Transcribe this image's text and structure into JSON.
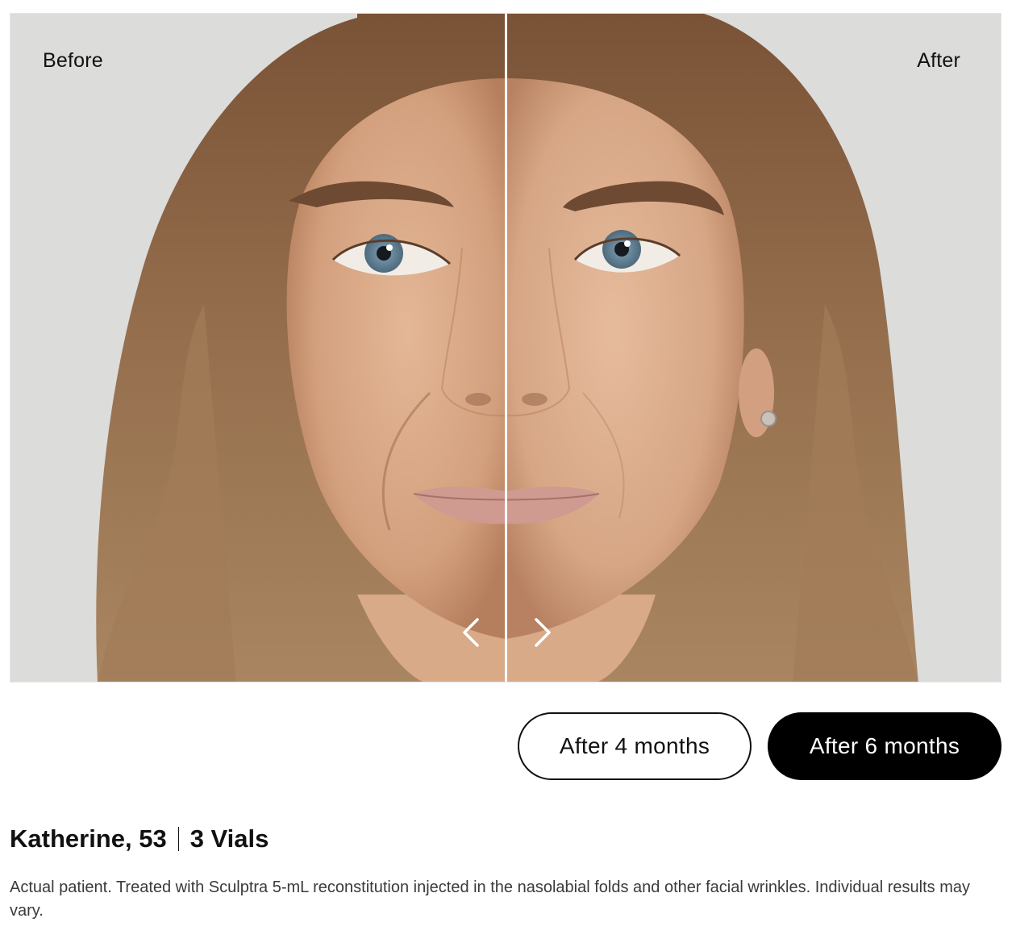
{
  "viewer": {
    "before_label": "Before",
    "after_label": "After",
    "prev_icon": "chevron-left-icon",
    "next_icon": "chevron-right-icon",
    "photo": "before-after-face-photo"
  },
  "timepoints": [
    {
      "label": "After 4 months",
      "selected": false
    },
    {
      "label": "After 6 months",
      "selected": true
    }
  ],
  "patient": {
    "name_age": "Katherine, 53",
    "vials": "3 Vials",
    "disclaimer": "Actual patient. Treated with Sculptra 5-mL reconstitution injected in the nasolabial folds and other facial wrinkles. Individual results may vary."
  },
  "colors": {
    "background": "#dcdcda",
    "selected_button": "#000000",
    "hair": "#8a6444",
    "skin": "#d8a987",
    "iris": "#6f8fa4",
    "lips": "#cf9a90"
  }
}
